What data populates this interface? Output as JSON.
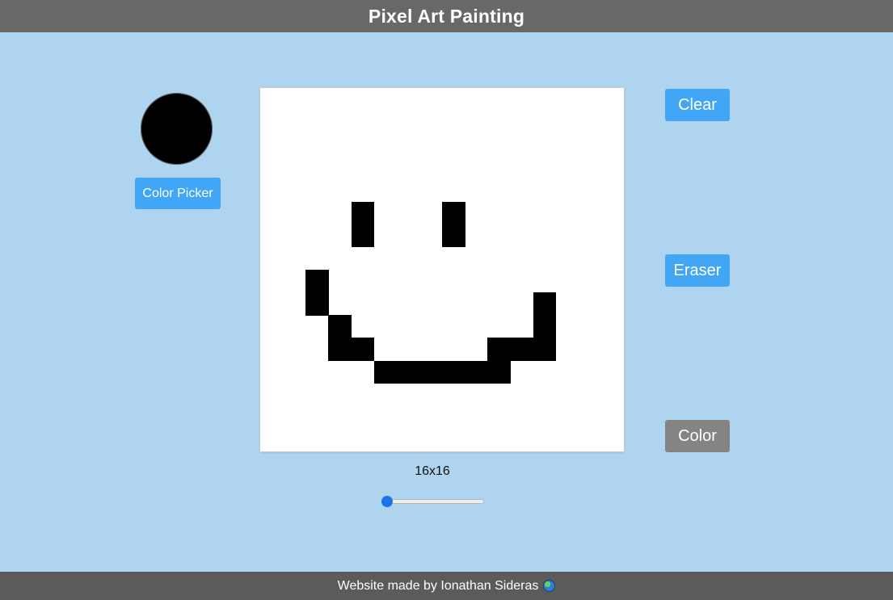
{
  "header": {
    "title": "Pixel Art Painting"
  },
  "color_picker": {
    "current_color": "#000000",
    "button_label": "Color Picker"
  },
  "tools": {
    "clear_label": "Clear",
    "eraser_label": "Eraser",
    "color_label": "Color"
  },
  "canvas": {
    "grid_size": 16,
    "background": "#ffffff",
    "paint_color": "#000000",
    "painted_cells": [
      [
        4,
        5
      ],
      [
        8,
        5
      ],
      [
        4,
        6
      ],
      [
        8,
        6
      ],
      [
        2,
        8
      ],
      [
        2,
        9
      ],
      [
        12,
        9
      ],
      [
        3,
        10
      ],
      [
        12,
        10
      ],
      [
        3,
        11
      ],
      [
        4,
        11
      ],
      [
        10,
        11
      ],
      [
        11,
        11
      ],
      [
        12,
        11
      ],
      [
        5,
        12
      ],
      [
        6,
        12
      ],
      [
        7,
        12
      ],
      [
        8,
        12
      ],
      [
        9,
        12
      ],
      [
        10,
        12
      ]
    ]
  },
  "size_control": {
    "label": "16x16",
    "slider_fraction": 0.0
  },
  "footer": {
    "text": "Website made by Ionathan Sideras",
    "icon": "globe-icon"
  }
}
